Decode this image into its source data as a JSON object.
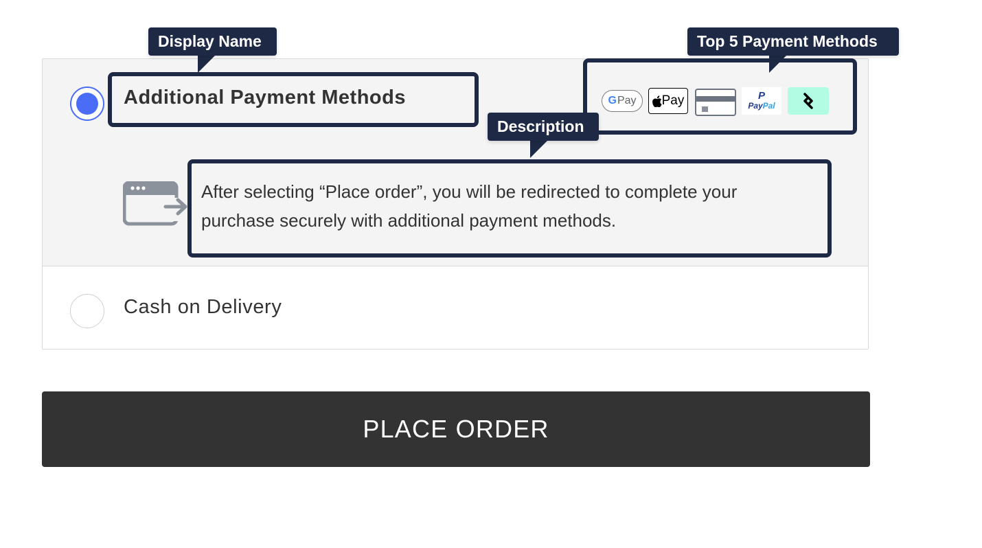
{
  "payment_options": [
    {
      "label": "Additional Payment Methods",
      "selected": true,
      "description": "After selecting “Place order”, you will be redirected to complete your purchase securely with additional payment methods.",
      "description_icon": "redirect-window-icon",
      "logos": [
        {
          "name": "google-pay-logo",
          "g": "G",
          "text": "Pay"
        },
        {
          "name": "apple-pay-logo",
          "text": "Pay"
        },
        {
          "name": "credit-card-logo"
        },
        {
          "name": "paypal-logo",
          "mark": "P",
          "word_a": "Pay",
          "word_b": "Pal"
        },
        {
          "name": "afterpay-logo"
        }
      ]
    },
    {
      "label": "Cash on Delivery",
      "selected": false
    }
  ],
  "place_order_label": "PLACE ORDER",
  "annotations": {
    "display_name": "Display Name",
    "top_payment_methods": "Top 5 Payment Methods",
    "description": "Description"
  },
  "colors": {
    "accent": "#4a6cf7",
    "annotation": "#1e2a45",
    "button_bg": "#333333",
    "afterpay_bg": "#b2fce4"
  }
}
